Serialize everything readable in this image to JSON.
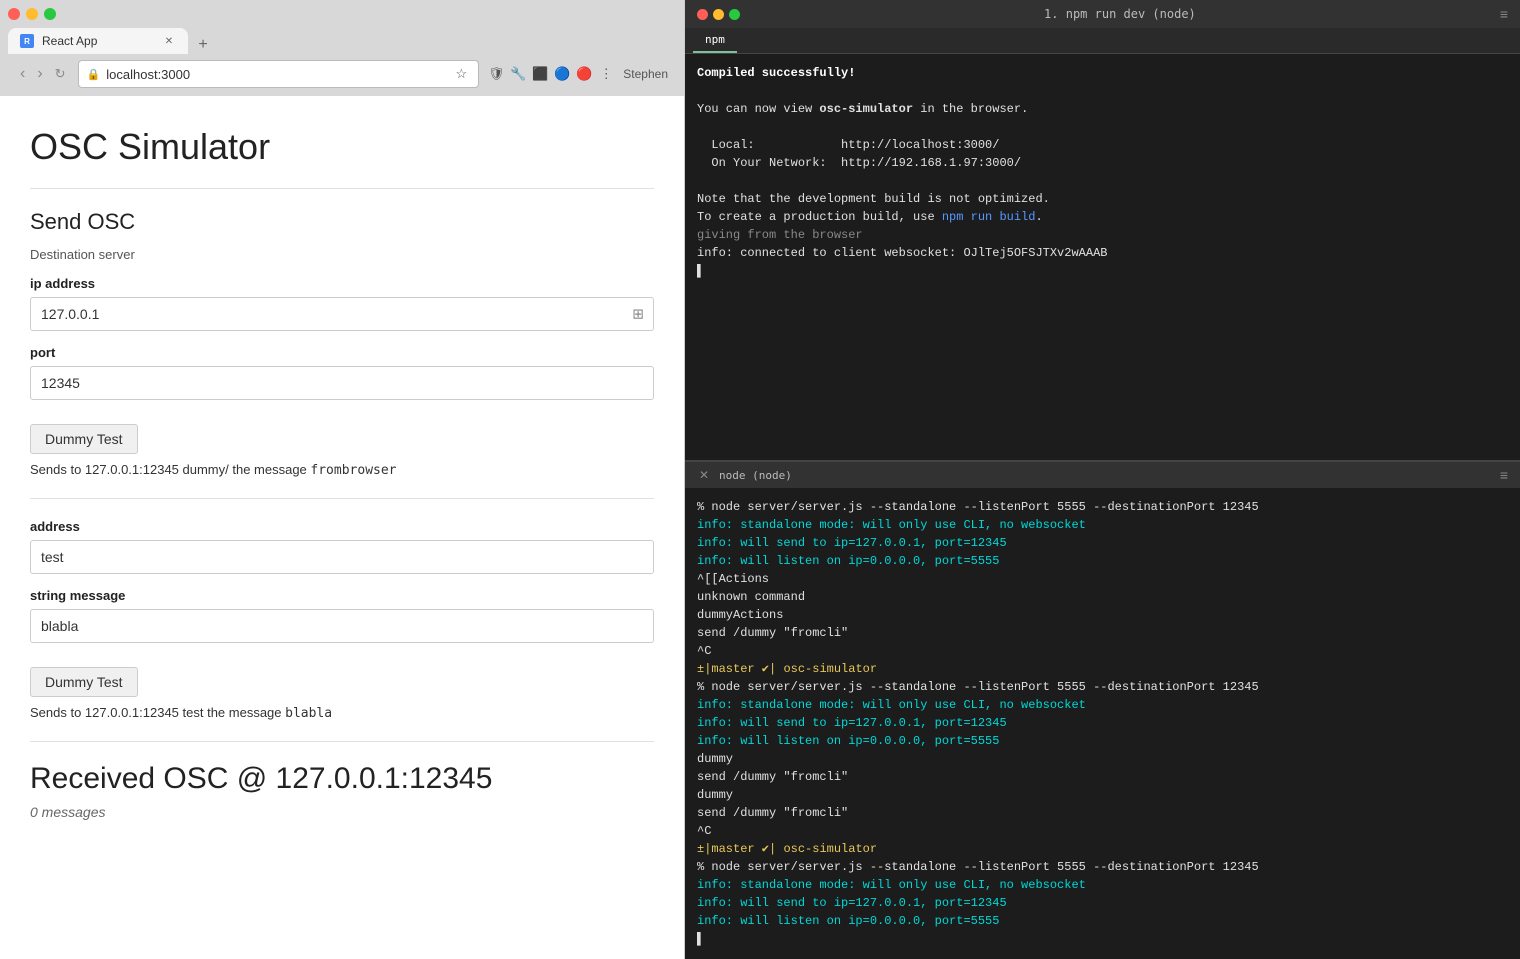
{
  "browser": {
    "tab_title": "React App",
    "tab_favicon_text": "R",
    "address": "localhost:3000",
    "user_label": "Stephen"
  },
  "app": {
    "title": "OSC Simulator",
    "send_section_title": "Send OSC",
    "destination_label": "Destination server",
    "ip_label": "ip address",
    "ip_value": "127.0.0.1",
    "port_label": "port",
    "port_value": "12345",
    "dummy_btn_1": "Dummy Test",
    "sends_label_1_pre": "Sends to 127.0.0.1:12345 dummy/ the message ",
    "sends_label_1_code": "frombrowser",
    "address_label": "address",
    "address_value": "test",
    "string_message_label": "string message",
    "string_value": "blabla",
    "dummy_btn_2": "Dummy Test",
    "sends_label_2_pre": "Sends to 127.0.0.1:12345 test the message ",
    "sends_label_2_code": "blabla",
    "received_title": "Received OSC @ 127.0.0.1:12345",
    "zero_messages": "0 messages"
  },
  "terminal1": {
    "title": "1. npm run dev (node)",
    "tab_label": "npm",
    "lines": [
      {
        "text": "Compiled successfully!",
        "class": "t-green t-bold-white"
      },
      {
        "text": "",
        "class": "t-white"
      },
      {
        "text": "You can now view ",
        "class": "t-white",
        "bold_text": "osc-simulator",
        "rest": " in the browser."
      },
      {
        "text": "",
        "class": "t-white"
      },
      {
        "text": "  Local:            http://localhost:3000/",
        "class": "t-white"
      },
      {
        "text": "  On Your Network:  http://192.168.1.97:3000/",
        "class": "t-white"
      },
      {
        "text": "",
        "class": "t-white"
      },
      {
        "text": "Note that the development build is not optimized.",
        "class": "t-white"
      },
      {
        "text": "To create a production build, use ",
        "class": "t-white",
        "npm_text": "npm run build",
        "rest2": "."
      },
      {
        "text": "giving from the browser",
        "class": "t-dim"
      },
      {
        "text": "info: connected to client websocket: OJlTej5OFSJTXv2wAAAB",
        "class": "t-white"
      },
      {
        "text": "▌",
        "class": "t-white"
      }
    ]
  },
  "terminal2": {
    "title": "node (node)",
    "lines": [
      {
        "text": "% node server/server.js --standalone --listenPort 5555 --destinationPort 12345",
        "class": "t-white"
      },
      {
        "text": "info: standalone mode: will only use CLI, no websocket",
        "class": "t-cyan"
      },
      {
        "text": "info: will send to ip=127.0.0.1, port=12345",
        "class": "t-cyan"
      },
      {
        "text": "info: will listen on ip=0.0.0.0, port=5555",
        "class": "t-cyan"
      },
      {
        "text": "^[[Actions",
        "class": "t-white"
      },
      {
        "text": "unknown command",
        "class": "t-white"
      },
      {
        "text": "dummyActions",
        "class": "t-white"
      },
      {
        "text": "send /dummy \"fromcli\"",
        "class": "t-white"
      },
      {
        "text": "^C",
        "class": "t-white"
      },
      {
        "text": "±|master ✔| osc-simulator",
        "class": "t-yellow"
      },
      {
        "text": "% node server/server.js --standalone --listenPort 5555 --destinationPort 12345",
        "class": "t-white"
      },
      {
        "text": "info: standalone mode: will only use CLI, no websocket",
        "class": "t-cyan"
      },
      {
        "text": "info: will send to ip=127.0.0.1, port=12345",
        "class": "t-cyan"
      },
      {
        "text": "info: will listen on ip=0.0.0.0, port=5555",
        "class": "t-cyan"
      },
      {
        "text": "dummy",
        "class": "t-white"
      },
      {
        "text": "send /dummy \"fromcli\"",
        "class": "t-white"
      },
      {
        "text": "dummy",
        "class": "t-white"
      },
      {
        "text": "send /dummy \"fromcli\"",
        "class": "t-white"
      },
      {
        "text": "^C",
        "class": "t-white"
      },
      {
        "text": "±|master ✔| osc-simulator",
        "class": "t-yellow"
      },
      {
        "text": "% node server/server.js --standalone --listenPort 5555 --destinationPort 12345",
        "class": "t-white"
      },
      {
        "text": "info: standalone mode: will only use CLI, no websocket",
        "class": "t-cyan"
      },
      {
        "text": "info: will send to ip=127.0.0.1, port=12345",
        "class": "t-cyan"
      },
      {
        "text": "info: will listen on ip=0.0.0.0, port=5555",
        "class": "t-cyan"
      },
      {
        "text": "▌",
        "class": "t-white"
      }
    ]
  }
}
